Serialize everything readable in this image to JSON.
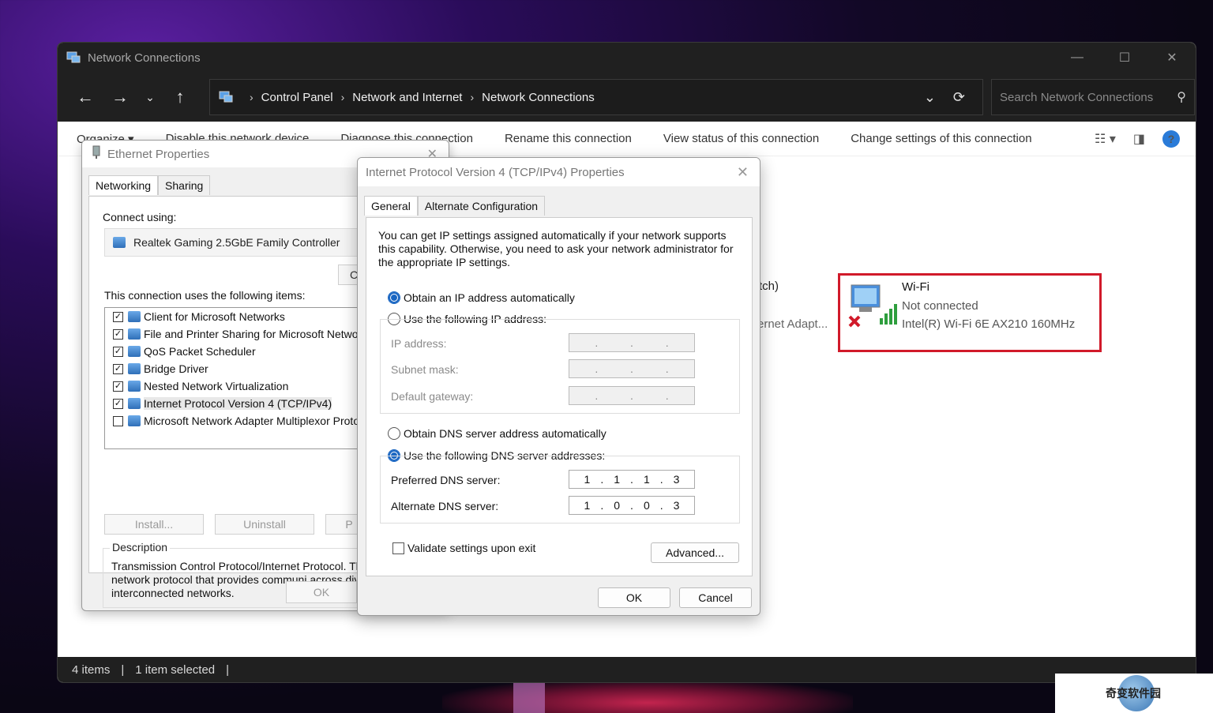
{
  "window": {
    "title": "Network Connections",
    "controls": {
      "minimize": "—",
      "maximize": "☐",
      "close": "✕"
    }
  },
  "nav": {
    "back": "←",
    "forward": "→",
    "recent": "⌄",
    "up": "↑"
  },
  "breadcrumb": [
    "Control Panel",
    "Network and Internet",
    "Network Connections"
  ],
  "breadcrumb_sep": "›",
  "search": {
    "placeholder": "Search Network Connections"
  },
  "commands": [
    "Organize ▾",
    "Disable this network device",
    "Diagnose this connection",
    "Rename this connection",
    "View status of this connection",
    "Change settings of this connection"
  ],
  "connections": {
    "ethernet_partial_name": "tch)",
    "ethernet_partial_adapter": "ernet Adapt...",
    "wifi": {
      "name": "Wi-Fi",
      "status": "Not connected",
      "adapter": "Intel(R) Wi-Fi 6E AX210 160MHz"
    }
  },
  "statusbar": {
    "items": "4 items",
    "selected": "1 item selected"
  },
  "ethernet_dialog": {
    "title": "Ethernet Properties",
    "tabs": [
      "Networking",
      "Sharing"
    ],
    "connect_using_label": "Connect using:",
    "adapter": "Realtek Gaming 2.5GbE Family Controller",
    "configure_partial": "C",
    "items_label": "This connection uses the following items:",
    "items": [
      {
        "label": "Client for Microsoft Networks",
        "checked": true
      },
      {
        "label": "File and Printer Sharing for Microsoft Networ",
        "checked": true
      },
      {
        "label": "QoS Packet Scheduler",
        "checked": true
      },
      {
        "label": "Bridge Driver",
        "checked": true
      },
      {
        "label": "Nested Network Virtualization",
        "checked": true
      },
      {
        "label": "Internet Protocol Version 4 (TCP/IPv4)",
        "checked": true
      },
      {
        "label": "Microsoft Network Adapter Multiplexor Proto",
        "checked": false
      }
    ],
    "buttons": {
      "install": "Install...",
      "uninstall": "Uninstall",
      "properties_partial": "P"
    },
    "description_label": "Description",
    "description": "Transmission Control Protocol/Internet Protocol. Th wide area network protocol that provides communi across diverse interconnected networks.",
    "ok": "OK"
  },
  "ipv4_dialog": {
    "title": "Internet Protocol Version 4 (TCP/IPv4) Properties",
    "tabs": [
      "General",
      "Alternate Configuration"
    ],
    "intro": "You can get IP settings assigned automatically if your network supports this capability. Otherwise, you need to ask your network administrator for the appropriate IP settings.",
    "ip_auto": "Obtain an IP address automatically",
    "ip_manual": "Use the following IP address:",
    "ip_address_label": "IP address:",
    "subnet_label": "Subnet mask:",
    "gateway_label": "Default gateway:",
    "dns_auto": "Obtain DNS server address automatically",
    "dns_manual": "Use the following DNS server addresses:",
    "preferred_label": "Preferred DNS server:",
    "alternate_label": "Alternate DNS server:",
    "preferred_dns": [
      "1",
      "1",
      "1",
      "3"
    ],
    "alternate_dns": [
      "1",
      "0",
      "0",
      "3"
    ],
    "validate": "Validate settings upon exit",
    "advanced": "Advanced...",
    "ok": "OK",
    "cancel": "Cancel"
  },
  "watermark": "奇变软件园"
}
